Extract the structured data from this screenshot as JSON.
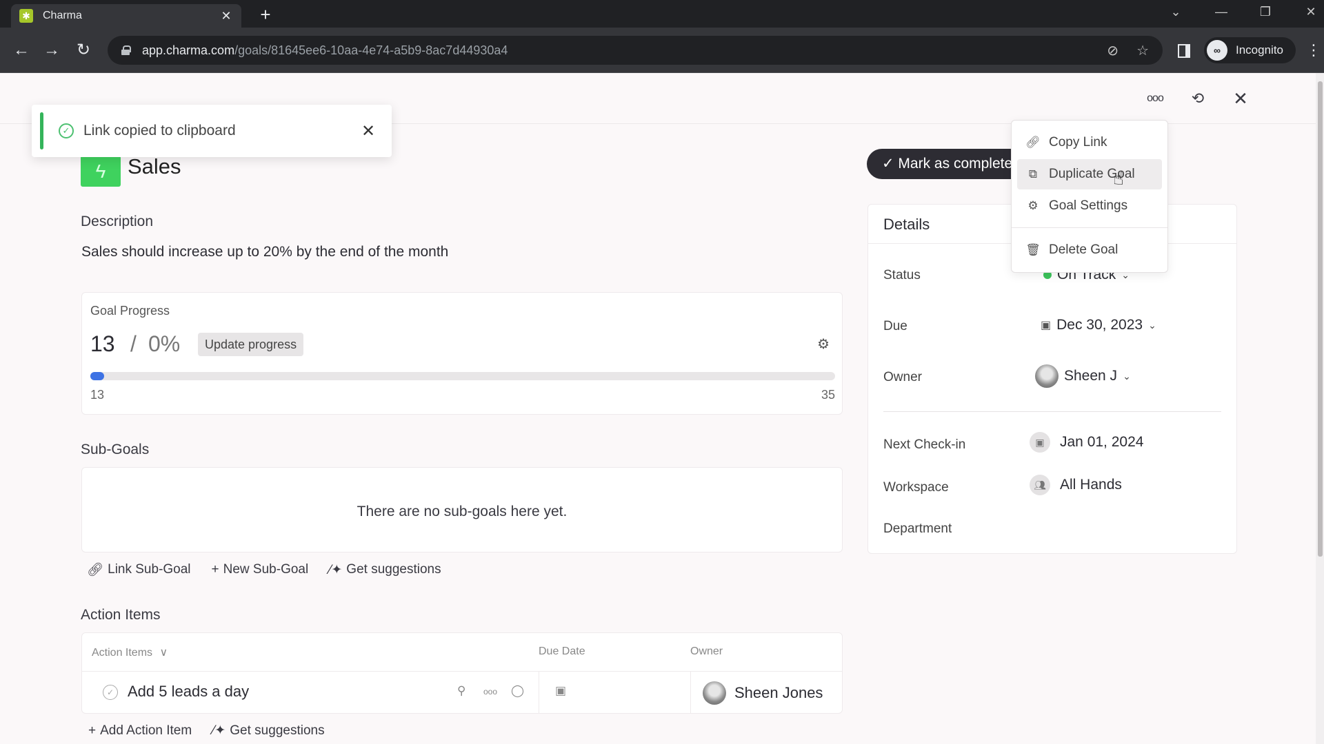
{
  "browser": {
    "tab_title": "Charma",
    "tab_favicon": "charma-logo-icon",
    "url_host": "app.charma.com",
    "url_path": "/goals/81645ee6-10aa-4e74-a5b9-8ac7d44930a4",
    "profile_label": "Incognito"
  },
  "toast": {
    "message": "Link copied to clipboard",
    "status_color": "#34b45a"
  },
  "goal": {
    "title": "Sales",
    "icon": "lightning-icon",
    "icon_color": "#3fd25e",
    "description_heading": "Description",
    "description": "Sales should increase up to 20% by the end of the month"
  },
  "progress": {
    "heading": "Goal Progress",
    "current": "13",
    "separator": "/",
    "percent_label": "0%",
    "update_button": "Update progress",
    "min": "13",
    "max": "35",
    "fill_fraction": 0.0,
    "bar_color": "#3d72e4"
  },
  "subgoals": {
    "heading": "Sub-Goals",
    "empty_message": "There are no sub-goals here yet.",
    "actions": [
      "Link Sub-Goal",
      "New Sub-Goal",
      "Get suggestions"
    ]
  },
  "action_items": {
    "heading": "Action Items",
    "columns": [
      "Action Items",
      "Due Date",
      "Owner"
    ],
    "rows": [
      {
        "title": "Add 5 leads a day",
        "due_date": "",
        "owner": "Sheen Jones"
      }
    ],
    "actions": [
      "Add Action Item",
      "Get suggestions"
    ]
  },
  "toolbar": {
    "mark_complete": "✓ Mark as complete"
  },
  "details": {
    "heading": "Details",
    "status_label": "Status",
    "status_value": "On Track",
    "status_color": "#3cc45b",
    "due_label": "Due",
    "due_value": "Dec 30, 2023",
    "owner_label": "Owner",
    "owner_value": "Sheen J",
    "checkin_label": "Next Check-in",
    "checkin_value": "Jan 01, 2024",
    "workspace_label": "Workspace",
    "workspace_value": "All Hands",
    "department_label": "Department"
  },
  "menu": {
    "items": [
      {
        "label": "Copy Link",
        "icon": "link-icon"
      },
      {
        "label": "Duplicate Goal",
        "icon": "copy-icon",
        "hovered": true
      },
      {
        "label": "Goal Settings",
        "icon": "gear-icon"
      },
      {
        "label": "Delete Goal",
        "icon": "trash-icon"
      }
    ]
  }
}
